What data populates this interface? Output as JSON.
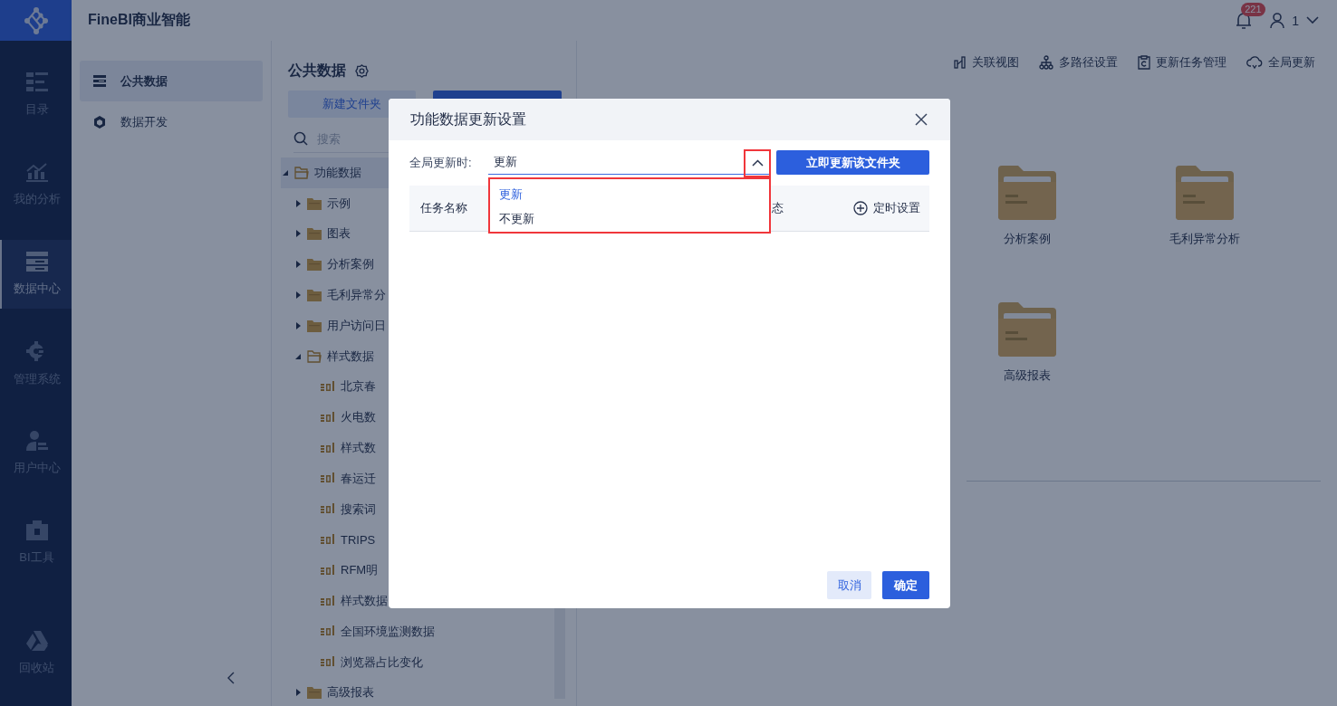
{
  "app": {
    "name": "FineBI商业智能"
  },
  "header": {
    "notification_count": "221",
    "user": "1"
  },
  "nav": [
    {
      "label": "目录",
      "selected": false
    },
    {
      "label": "我的分析",
      "selected": false
    },
    {
      "label": "数据中心",
      "selected": true
    },
    {
      "label": "管理系统",
      "selected": false
    },
    {
      "label": "用户中心",
      "selected": false
    },
    {
      "label": "BI工具",
      "selected": false
    },
    {
      "label": "回收站",
      "selected": false
    }
  ],
  "sidebar": {
    "items": [
      {
        "label": "公共数据",
        "selected": true
      },
      {
        "label": "数据开发",
        "selected": false
      }
    ]
  },
  "tree_panel": {
    "title": "公共数据",
    "new_folder_button": "新建文件夹",
    "search": {
      "placeholder": "搜索"
    },
    "tree": [
      {
        "label": "功能数据",
        "kind": "folder",
        "expanded": true,
        "selected": true,
        "children": [
          {
            "label": "示例",
            "kind": "folder",
            "expanded": false,
            "selected": false
          },
          {
            "label": "图表",
            "kind": "folder",
            "expanded": false,
            "selected": false
          },
          {
            "label": "分析案例",
            "kind": "folder",
            "expanded": false,
            "selected": false
          },
          {
            "label": "毛利异常分",
            "kind": "folder",
            "expanded": false,
            "selected": false
          },
          {
            "label": "用户访问日",
            "kind": "folder",
            "expanded": false,
            "selected": false
          },
          {
            "label": "样式数据",
            "kind": "folder",
            "expanded": true,
            "selected": false,
            "children": [
              {
                "label": "北京春",
                "kind": "sql",
                "selected": false
              },
              {
                "label": "火电数",
                "kind": "sql",
                "selected": false
              },
              {
                "label": "样式数",
                "kind": "sql",
                "selected": false
              },
              {
                "label": "春运迁",
                "kind": "sql",
                "selected": false
              },
              {
                "label": "搜索词",
                "kind": "sql",
                "selected": false
              },
              {
                "label": "TRIPS",
                "kind": "sql",
                "selected": false
              },
              {
                "label": "RFM明",
                "kind": "sql",
                "selected": false
              },
              {
                "label": "样式数据",
                "kind": "sql",
                "selected": false
              },
              {
                "label": "全国环境监测数据",
                "kind": "sql",
                "selected": false
              },
              {
                "label": "浏览器占比变化",
                "kind": "sql",
                "selected": false
              }
            ]
          },
          {
            "label": "高级报表",
            "kind": "folder",
            "expanded": false,
            "selected": false
          }
        ]
      }
    ]
  },
  "toolbar": [
    {
      "label": "关联视图"
    },
    {
      "label": "多路径设置"
    },
    {
      "label": "更新任务管理"
    },
    {
      "label": "全局更新"
    }
  ],
  "folders": [
    {
      "label": "分析案例"
    },
    {
      "label": "毛利异常分析"
    },
    {
      "label": "高级报表"
    }
  ],
  "dialog": {
    "title": "功能数据更新设置",
    "global_update": {
      "label": "全局更新时:",
      "value": "更新",
      "expanded": true,
      "options": [
        {
          "label": "更新",
          "selected": true
        },
        {
          "label": "不更新",
          "selected": false
        }
      ]
    },
    "update_now_button": "立即更新该文件夹",
    "table": {
      "columns": [
        "任务名称",
        "态"
      ],
      "schedule_button": "定时设置"
    },
    "buttons": {
      "cancel": "取消",
      "ok": "确定"
    }
  }
}
